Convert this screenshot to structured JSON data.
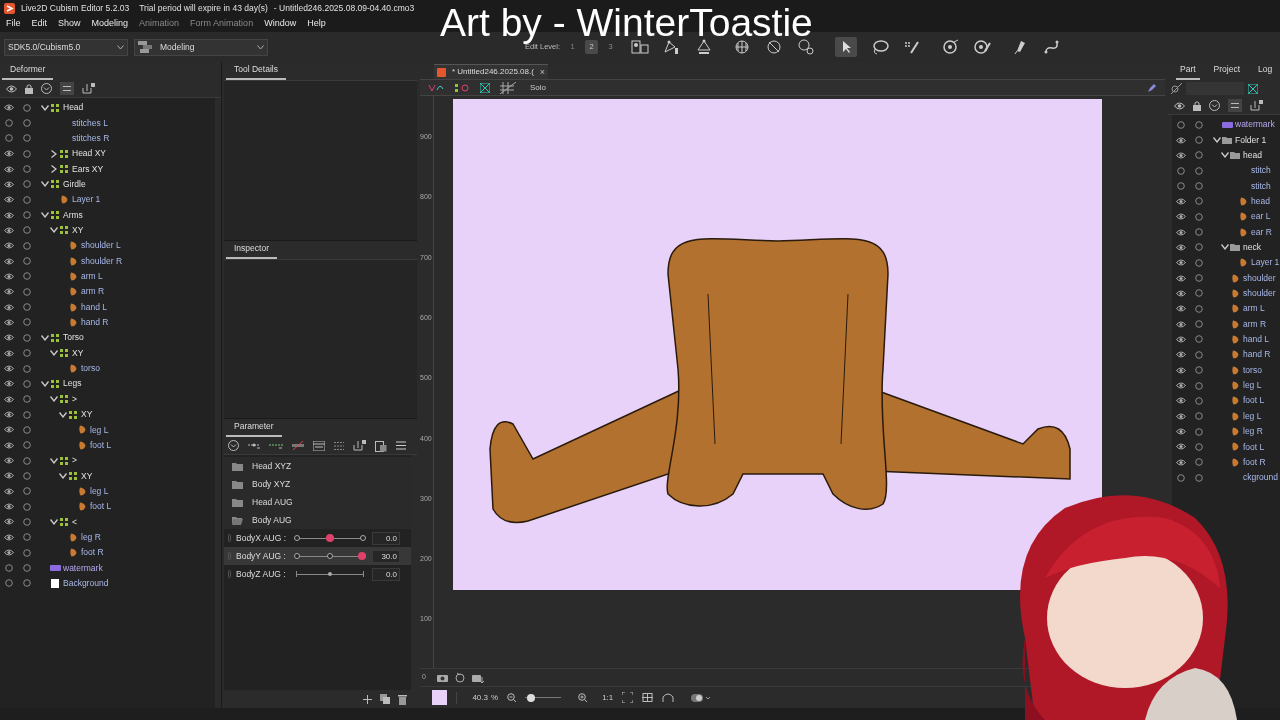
{
  "title_bar": {
    "app": "Live2D Cubism Editor 5.2.03",
    "notice": "Trial period will expire in 43 day(s)",
    "file": "- Untitled246.2025.08.09-04.40.cmo3"
  },
  "overlay_caption": "Art by - WinterToastie",
  "menu": [
    {
      "label": "File",
      "disabled": false
    },
    {
      "label": "Edit",
      "disabled": false
    },
    {
      "label": "Show",
      "disabled": false
    },
    {
      "label": "Modeling",
      "disabled": false
    },
    {
      "label": "Animation",
      "disabled": true
    },
    {
      "label": "Form Animation",
      "disabled": true
    },
    {
      "label": "Window",
      "disabled": false
    },
    {
      "label": "Help",
      "disabled": false
    }
  ],
  "toolbar": {
    "sdk": "SDK5.0/Cubism5.0",
    "mode": "Modeling",
    "edit_level_label": "Edit Level:",
    "edit_levels": [
      {
        "label": "1",
        "selected": false
      },
      {
        "label": "2",
        "selected": true
      },
      {
        "label": "3",
        "selected": false
      }
    ]
  },
  "deformer_panel": {
    "tab": "Deformer",
    "tree": [
      {
        "label": "Head",
        "kind": "warp",
        "visible": true,
        "expanded": true,
        "children": [
          {
            "label": "stitches L",
            "kind": "plain",
            "visible": false
          },
          {
            "label": "stitches R",
            "kind": "plain",
            "visible": false
          },
          {
            "label": "Head XY",
            "kind": "warp",
            "visible": true,
            "expanded": false
          },
          {
            "label": "Ears XY",
            "kind": "warp",
            "visible": true,
            "expanded": false
          }
        ]
      },
      {
        "label": "Girdle",
        "kind": "warp",
        "visible": true,
        "expanded": true,
        "children": [
          {
            "label": "Layer 1",
            "kind": "mesh",
            "visible": true
          }
        ]
      },
      {
        "label": "Arms",
        "kind": "warp",
        "visible": true,
        "expanded": true,
        "children": [
          {
            "label": "XY",
            "kind": "warp",
            "visible": true,
            "expanded": true,
            "children": [
              {
                "label": "shoulder L",
                "kind": "mesh",
                "visible": true
              },
              {
                "label": "shoulder R",
                "kind": "mesh",
                "visible": true
              },
              {
                "label": "arm L",
                "kind": "mesh",
                "visible": true
              },
              {
                "label": "arm R",
                "kind": "mesh",
                "visible": true
              },
              {
                "label": "hand L",
                "kind": "mesh",
                "visible": true
              },
              {
                "label": "hand R",
                "kind": "mesh",
                "visible": true
              }
            ]
          }
        ]
      },
      {
        "label": "Torso",
        "kind": "warp",
        "visible": true,
        "expanded": true,
        "children": [
          {
            "label": "XY",
            "kind": "warp",
            "visible": true,
            "expanded": true,
            "children": [
              {
                "label": "torso",
                "kind": "mesh",
                "visible": true
              }
            ]
          }
        ]
      },
      {
        "label": "Legs",
        "kind": "warp",
        "visible": true,
        "expanded": true,
        "children": [
          {
            "label": ">",
            "kind": "warp",
            "visible": true,
            "expanded": true,
            "children": [
              {
                "label": "XY",
                "kind": "warp",
                "visible": true,
                "expanded": true,
                "children": [
                  {
                    "label": "leg L",
                    "kind": "mesh",
                    "visible": true
                  },
                  {
                    "label": "foot L",
                    "kind": "mesh",
                    "visible": true
                  }
                ]
              }
            ]
          },
          {
            "label": ">",
            "kind": "warp",
            "visible": true,
            "expanded": true,
            "children": [
              {
                "label": "XY",
                "kind": "warp",
                "visible": true,
                "expanded": true,
                "children": [
                  {
                    "label": "leg L",
                    "kind": "mesh",
                    "visible": true
                  },
                  {
                    "label": "foot L",
                    "kind": "mesh",
                    "visible": true
                  }
                ]
              }
            ]
          },
          {
            "label": "<",
            "kind": "warp",
            "visible": true,
            "expanded": true,
            "children": [
              {
                "label": "leg R",
                "kind": "mesh",
                "visible": true
              },
              {
                "label": "foot R",
                "kind": "mesh",
                "visible": true
              }
            ]
          }
        ]
      },
      {
        "label": "watermark",
        "kind": "group",
        "visible": false
      },
      {
        "label": "Background",
        "kind": "background",
        "visible": false
      }
    ]
  },
  "tool_details": {
    "tab": "Tool Details"
  },
  "inspector": {
    "tab": "Inspector"
  },
  "parameter_panel": {
    "tab": "Parameter",
    "groups": [
      {
        "label": "Head XYZ",
        "expanded": false
      },
      {
        "label": "Body XYZ",
        "expanded": false
      },
      {
        "label": "Head AUG",
        "expanded": false
      },
      {
        "label": "Body AUG",
        "expanded": true
      }
    ],
    "parameters": [
      {
        "name": "BodyX AUG :",
        "keyed": true,
        "level": 0.5,
        "value": "0.0",
        "selected": false
      },
      {
        "name": "BodyY AUG :",
        "keyed": true,
        "level": 1,
        "value": "30.0",
        "selected": true
      },
      {
        "name": "BodyZ AUG :",
        "keyed": false,
        "level": 0.5,
        "value": "0.0",
        "selected": false
      }
    ]
  },
  "canvas": {
    "tab": "* Untitled246.2025.08.(",
    "close": "×",
    "solo": "Solo",
    "ruler": [
      "900",
      "800",
      "700",
      "600",
      "500",
      "400",
      "300",
      "200",
      "100",
      "0"
    ],
    "zoom": "40.3",
    "zoom_slider": {
      "level": 0.05
    },
    "zoom_unit": "%",
    "actual_size": "1:1"
  },
  "part_panel": {
    "tabs": [
      {
        "label": "Part",
        "selected": true
      },
      {
        "label": "Project",
        "selected": false
      },
      {
        "label": "Log",
        "selected": false
      }
    ],
    "tree": [
      {
        "label": "watermark",
        "kind": "group",
        "visible": false
      },
      {
        "label": "Folder 1",
        "kind": "folder",
        "visible": true,
        "expanded": true,
        "children": [
          {
            "label": "head",
            "kind": "folder",
            "visible": true,
            "expanded": true,
            "children": [
              {
                "label": "stitch",
                "kind": "plain",
                "visible": false
              },
              {
                "label": "stitch",
                "kind": "plain",
                "visible": false
              },
              {
                "label": "head",
                "kind": "mesh",
                "visible": true
              },
              {
                "label": "ear L",
                "kind": "mesh",
                "visible": true
              },
              {
                "label": "ear R",
                "kind": "mesh",
                "visible": true
              }
            ]
          },
          {
            "label": "neck",
            "kind": "folder",
            "visible": true,
            "expanded": true,
            "children": [
              {
                "label": "Layer 1",
                "kind": "mesh",
                "visible": true
              }
            ]
          },
          {
            "label": "shoulder",
            "kind": "mesh",
            "visible": true
          },
          {
            "label": "shoulder",
            "kind": "mesh",
            "visible": true
          },
          {
            "label": "arm L",
            "kind": "mesh",
            "visible": true
          },
          {
            "label": "arm R",
            "kind": "mesh",
            "visible": true
          },
          {
            "label": "hand L",
            "kind": "mesh",
            "visible": true
          },
          {
            "label": "hand R",
            "kind": "mesh",
            "visible": true
          },
          {
            "label": "torso",
            "kind": "mesh",
            "visible": true
          },
          {
            "label": "leg L",
            "kind": "mesh",
            "visible": true
          },
          {
            "label": "foot L",
            "kind": "mesh",
            "visible": true
          },
          {
            "label": "leg L",
            "kind": "mesh",
            "visible": true
          },
          {
            "label": "leg R",
            "kind": "mesh",
            "visible": true
          },
          {
            "label": "foot L",
            "kind": "mesh",
            "visible": true
          },
          {
            "label": "foot R",
            "kind": "mesh",
            "visible": true
          },
          {
            "label": "ckground",
            "kind": "plain",
            "visible": false
          }
        ]
      }
    ]
  }
}
